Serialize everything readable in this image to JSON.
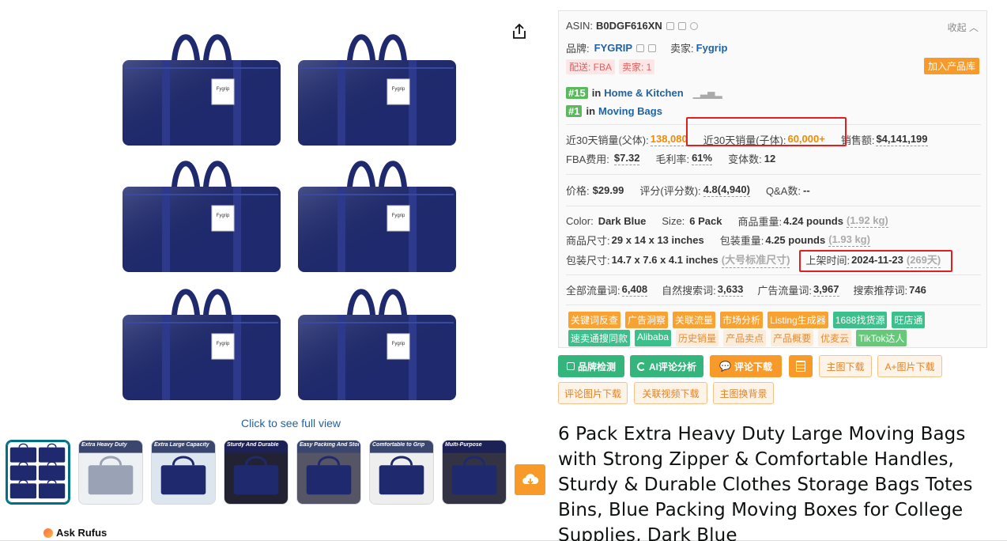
{
  "gallery": {
    "full_view_link": "Click to see full view",
    "bag_label": "Fygrip",
    "thumbnails": [
      {
        "caption": ""
      },
      {
        "caption": "Extra Heavy Duty"
      },
      {
        "caption": "Extra Large Capacity"
      },
      {
        "caption": "Sturdy And Durable"
      },
      {
        "caption": "Easy Packing And Storage"
      },
      {
        "caption": "Comfortable to Grip"
      },
      {
        "caption": "Multi-Purpose"
      }
    ]
  },
  "rufus": {
    "label": "Ask Rufus"
  },
  "panel": {
    "asin_label": "ASIN:",
    "asin": "B0DGF616XN",
    "collapse": "收起",
    "brand_label": "品牌:",
    "brand": "FYGRIP",
    "seller_label": "卖家:",
    "seller": "Fygrip",
    "fulfillment_tag": "配送: FBA",
    "seller_count_tag": "卖家: 1",
    "add_to_library": "加入产品库",
    "ranks": [
      {
        "rank": "#15",
        "in": "in",
        "category": "Home & Kitchen"
      },
      {
        "rank": "#1",
        "in": "in",
        "category": "Moving Bags"
      }
    ],
    "sales_parent_label": "近30天销量(父体):",
    "sales_parent": "138,080",
    "sales_child_label": "近30天销量(子体):",
    "sales_child": "60,000+",
    "revenue_label": "销售额:",
    "revenue": "$4,141,199",
    "fba_fee_label": "FBA费用:",
    "fba_fee": "$7.32",
    "margin_label": "毛利率:",
    "margin": "61%",
    "variants_label": "变体数:",
    "variants": "12",
    "price_label": "价格:",
    "price": "$29.99",
    "rating_label": "评分(评分数):",
    "rating": "4.8(4,940)",
    "qa_label": "Q&A数:",
    "qa": "--",
    "color_label": "Color:",
    "color": "Dark Blue",
    "size_label": "Size:",
    "size": "6 Pack",
    "weight_label": "商品重量:",
    "weight": "4.24 pounds",
    "weight_kg": "(1.92 kg)",
    "dims_label": "商品尺寸:",
    "dims": "29 x 14 x 13 inches",
    "pkg_weight_label": "包装重量:",
    "pkg_weight": "4.25 pounds",
    "pkg_weight_kg": "(1.93 kg)",
    "pkg_dims_label": "包装尺寸:",
    "pkg_dims": "14.7 x 7.6 x 4.1 inches",
    "pkg_size_class": "(大号标准尺寸)",
    "listed_label": "上架时间:",
    "listed": "2024-11-23",
    "listed_days": "(269天)",
    "traffic_label": "全部流量词:",
    "traffic": "6,408",
    "organic_label": "自然搜索词:",
    "organic": "3,633",
    "ad_label": "广告流量词:",
    "ad": "3,967",
    "recommend_label": "搜索推荐词:",
    "recommend": "746",
    "tools_row1": [
      "关键词反查",
      "广告洞察",
      "关联流量",
      "市场分析",
      "Listing生成器",
      "1688找货源",
      "旺店通"
    ],
    "tools_row2": [
      "速卖通搜同款",
      "Alibaba",
      "历史销量",
      "产品卖点",
      "产品概要",
      "优麦云",
      "TikTok达人"
    ]
  },
  "actions": {
    "brand_check": "品牌检测",
    "ai_review": "AI评论分析",
    "review_download": "评论下载",
    "main_image_download": "主图下载",
    "a_plus_download": "A+图片下载",
    "review_image_download": "评论图片下载",
    "related_video_download": "关联视频下载",
    "main_image_bg": "主图换背景"
  },
  "product_title": "6 Pack Extra Heavy Duty Large Moving Bags with Strong Zipper & Comfortable Handles, Sturdy & Durable Clothes Storage Bags Totes Bins, Blue Packing Moving Boxes for College Supplies, Dark Blue",
  "colors": {
    "bag": "#1f2a6e",
    "accent": "#f79a2a",
    "green": "#34b57b",
    "link": "#2162a1",
    "highlight": "#e02020"
  }
}
